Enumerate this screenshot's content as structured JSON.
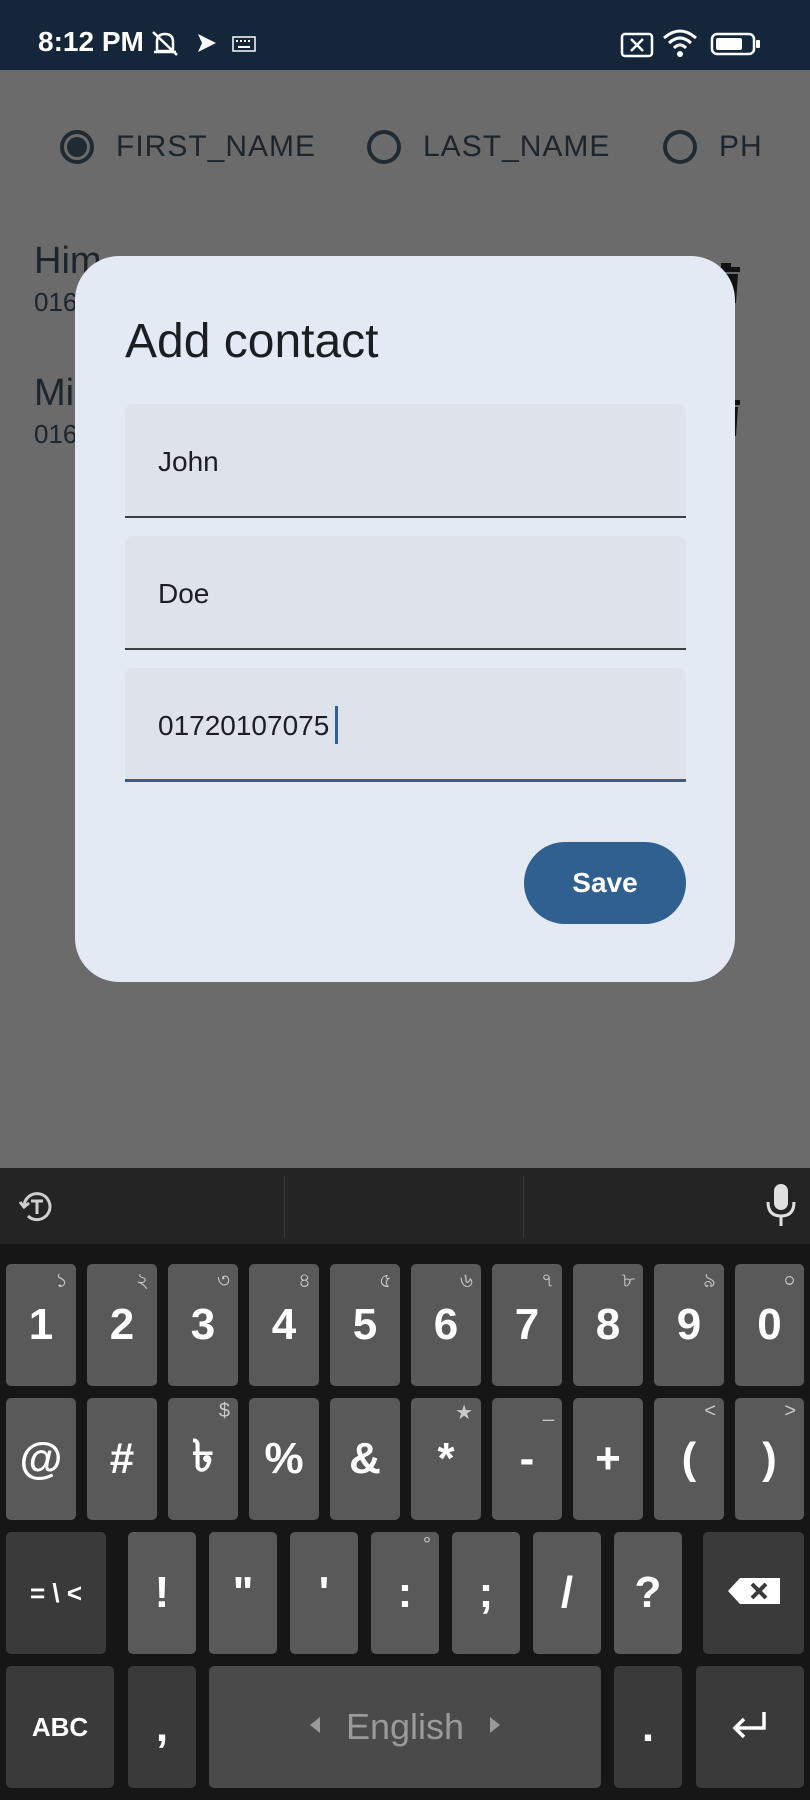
{
  "status_bar": {
    "time": "8:12 PM",
    "icons": [
      "mute-alarm-icon",
      "send-icon",
      "keyboard-icon",
      "no-sim-icon",
      "wifi-icon",
      "battery-icon"
    ]
  },
  "background": {
    "radio_options": [
      {
        "label": "FIRST_NAME",
        "selected": true
      },
      {
        "label": "LAST_NAME",
        "selected": false
      },
      {
        "label": "PH",
        "selected": false
      }
    ],
    "contacts": [
      {
        "name": "Him",
        "phone": "016"
      },
      {
        "name": "Mi",
        "phone": "016"
      }
    ]
  },
  "dialog": {
    "title": "Add contact",
    "first_name": "John",
    "last_name": "Doe",
    "phone": "01720107075",
    "save_label": "Save",
    "accent": "#2f6090"
  },
  "keyboard": {
    "row1": [
      {
        "main": "1",
        "hint": "১"
      },
      {
        "main": "2",
        "hint": "২"
      },
      {
        "main": "3",
        "hint": "৩"
      },
      {
        "main": "4",
        "hint": "৪"
      },
      {
        "main": "5",
        "hint": "৫"
      },
      {
        "main": "6",
        "hint": "৬"
      },
      {
        "main": "7",
        "hint": "৭"
      },
      {
        "main": "8",
        "hint": "৮"
      },
      {
        "main": "9",
        "hint": "৯"
      },
      {
        "main": "0",
        "hint": "০"
      }
    ],
    "row2": [
      {
        "main": "@",
        "hint": ""
      },
      {
        "main": "#",
        "hint": ""
      },
      {
        "main": "৳",
        "hint": "$"
      },
      {
        "main": "%",
        "hint": ""
      },
      {
        "main": "&",
        "hint": ""
      },
      {
        "main": "*",
        "hint": "★"
      },
      {
        "main": "-",
        "hint": "_"
      },
      {
        "main": "+",
        "hint": ""
      },
      {
        "main": "(",
        "hint": "<"
      },
      {
        "main": ")",
        "hint": ">"
      }
    ],
    "row3_left": "= \\ <",
    "row3": [
      {
        "main": "!",
        "hint": ""
      },
      {
        "main": "\"",
        "hint": ""
      },
      {
        "main": "'",
        "hint": ""
      },
      {
        "main": ":",
        "hint": "°"
      },
      {
        "main": ";",
        "hint": ""
      },
      {
        "main": "/",
        "hint": ""
      },
      {
        "main": "?",
        "hint": ""
      }
    ],
    "abc_label": "ABC",
    "comma": ",",
    "space_label": "English",
    "period": "."
  }
}
